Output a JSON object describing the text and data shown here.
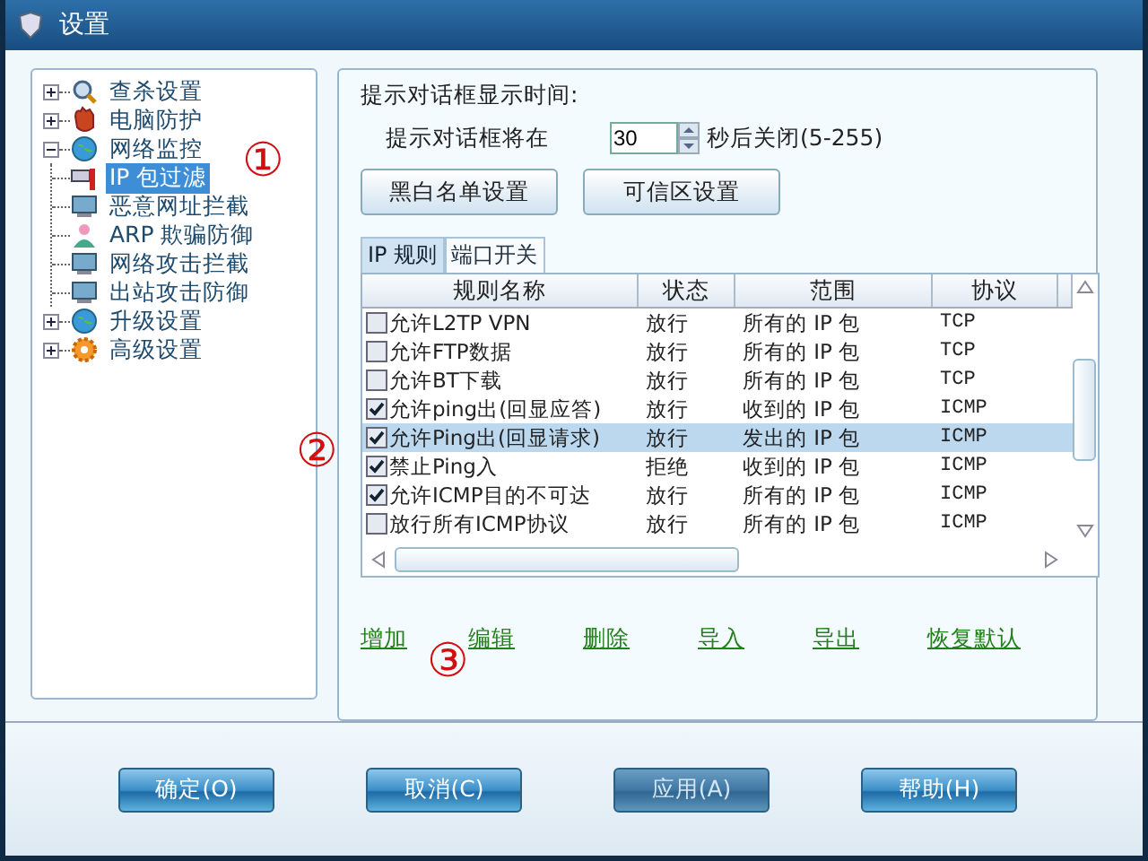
{
  "window": {
    "title": "设置"
  },
  "tree": [
    {
      "label": "查杀设置",
      "kind": "search",
      "expanded": false
    },
    {
      "label": "电脑防护",
      "kind": "glove",
      "expanded": false
    },
    {
      "label": "网络监控",
      "kind": "globe",
      "expanded": true,
      "children": [
        {
          "label": "IP 包过滤",
          "kind": "tool",
          "selected": true
        },
        {
          "label": "恶意网址拦截",
          "kind": "screen",
          "selected": false
        },
        {
          "label": "ARP 欺骗防御",
          "kind": "user",
          "selected": false
        },
        {
          "label": "网络攻击拦截",
          "kind": "screen",
          "selected": false
        },
        {
          "label": "出站攻击防御",
          "kind": "screen",
          "selected": false
        }
      ]
    },
    {
      "label": "升级设置",
      "kind": "globe",
      "expanded": false
    },
    {
      "label": "高级设置",
      "kind": "gear",
      "expanded": false
    }
  ],
  "prompt": {
    "heading": "提示对话框显示时间:",
    "label": "提示对话框将在",
    "value": "30",
    "suffix": "秒后关闭(5-255)"
  },
  "buttons_top": [
    "黑白名单设置",
    "可信区设置"
  ],
  "tabs": [
    {
      "label": "IP 规则",
      "selected": true
    },
    {
      "label": "端口开关",
      "selected": false
    }
  ],
  "table": {
    "columns": [
      "规则名称",
      "状态",
      "范围",
      "协议"
    ],
    "rows": [
      {
        "name": "允许L2TP VPN",
        "checked": false,
        "selected": false,
        "state": "放行",
        "range": "所有的 IP 包",
        "protocol": "TCP"
      },
      {
        "name": "允许FTP数据",
        "checked": false,
        "selected": false,
        "state": "放行",
        "range": "所有的 IP 包",
        "protocol": "TCP"
      },
      {
        "name": "允许BT下载",
        "checked": false,
        "selected": false,
        "state": "放行",
        "range": "所有的 IP 包",
        "protocol": "TCP"
      },
      {
        "name": "允许ping出(回显应答)",
        "checked": true,
        "selected": false,
        "state": "放行",
        "range": "收到的 IP 包",
        "protocol": "ICMP"
      },
      {
        "name": "允许Ping出(回显请求)",
        "checked": true,
        "selected": true,
        "state": "放行",
        "range": "发出的 IP 包",
        "protocol": "ICMP"
      },
      {
        "name": "禁止Ping入",
        "checked": true,
        "selected": false,
        "state": "拒绝",
        "range": "收到的 IP 包",
        "protocol": "ICMP"
      },
      {
        "name": "允许ICMP目的不可达",
        "checked": true,
        "selected": false,
        "state": "放行",
        "range": "所有的 IP 包",
        "protocol": "ICMP"
      },
      {
        "name": "放行所有ICMP协议",
        "checked": false,
        "selected": false,
        "state": "放行",
        "range": "所有的 IP 包",
        "protocol": "ICMP"
      }
    ]
  },
  "links": [
    "增加",
    "编辑",
    "删除",
    "导入",
    "导出",
    "恢复默认"
  ],
  "buttons": [
    {
      "label": "确定(O)",
      "disabled": false
    },
    {
      "label": "取消(C)",
      "disabled": false
    },
    {
      "label": "应用(A)",
      "disabled": true
    },
    {
      "label": "帮助(H)",
      "disabled": false
    }
  ],
  "annotations": [
    "①",
    "②",
    "③"
  ]
}
